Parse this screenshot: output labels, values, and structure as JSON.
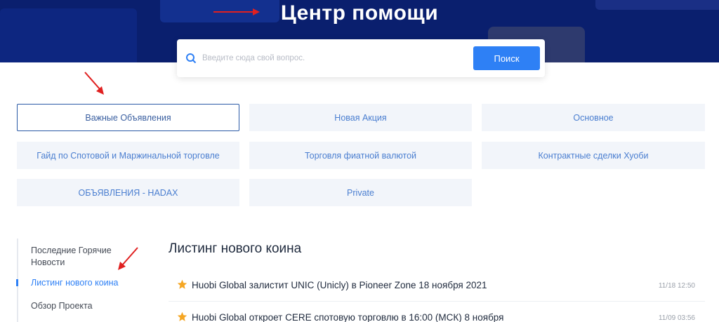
{
  "header": {
    "title": "Центр помощи"
  },
  "search": {
    "placeholder": "Введите сюда свой вопрос.",
    "button_label": "Поиск"
  },
  "categories": [
    {
      "label": "Важные Объявления",
      "active": true
    },
    {
      "label": "Новая Акция"
    },
    {
      "label": "Основное"
    },
    {
      "label": "Гайд по Спотовой и Маржинальной торговле"
    },
    {
      "label": "Торговля фиатной валютой"
    },
    {
      "label": "Контрактные сделки Хуоби"
    },
    {
      "label": "ОБЪЯВЛЕНИЯ - HADAX"
    },
    {
      "label": "Private"
    }
  ],
  "sidebar": {
    "items": [
      {
        "label": "Последние Горячие Новости"
      },
      {
        "label": "Листинг нового коина",
        "active": true
      },
      {
        "label": "Обзор Проекта"
      }
    ]
  },
  "main": {
    "title": "Листинг нового коина",
    "articles": [
      {
        "title": "Huobi Global залистит UNIC (Unicly) в Pioneer Zone 18 ноября 2021",
        "date": "11/18 12:50"
      },
      {
        "title": "Huobi Global откроет CERE спотовую торговлю в 16:00 (МСК) 8 ноября",
        "date": "11/09 03:56"
      }
    ]
  },
  "colors": {
    "hero_bg": "#0a1f6e",
    "accent": "#2e80f5",
    "annotation_arrow": "#e02020",
    "star": "#f5a623"
  }
}
